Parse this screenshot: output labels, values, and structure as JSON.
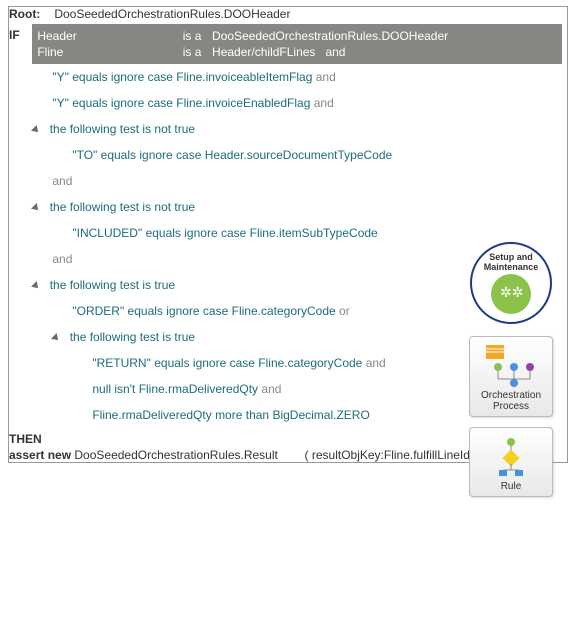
{
  "root": {
    "label": "Root:",
    "value": "DooSeededOrchestrationRules.DOOHeader"
  },
  "if_label": "IF",
  "header_block": {
    "l1c1": "Header",
    "isa": "is a",
    "l1c2": "DooSeededOrchestrationRules.DOOHeader",
    "l2c1": "Fline",
    "l2c2": "Header/childFLines",
    "and": "and"
  },
  "k": {
    "and": "and",
    "or": "or",
    "eqic": "equals ignore case",
    "nottrue": "the following test is not true",
    "istrue": "the following test is true",
    "isnt": "isn't",
    "morethan": "more than"
  },
  "c1": {
    "lit": "\"Y\"",
    "field": "Fline.invoiceableItemFlag"
  },
  "c2": {
    "lit": "\"Y\"",
    "field": "Fline.invoiceEnabledFlag"
  },
  "c3": {
    "lit": "\"TO\"",
    "field": "Header.sourceDocumentTypeCode"
  },
  "c4": {
    "lit": "\"INCLUDED\"",
    "field": "Fline.itemSubTypeCode"
  },
  "c5": {
    "lit": "\"ORDER\"",
    "field": "Fline.categoryCode"
  },
  "c6": {
    "lit": "\"RETURN\"",
    "field": "Fline.categoryCode"
  },
  "c7": {
    "null": "null",
    "field": "Fline.rmaDeliveredQty"
  },
  "c8": {
    "field": "Fline.rmaDeliveredQty",
    "val": "BigDecimal.ZERO"
  },
  "then": {
    "label": "THEN",
    "assert": "assert new",
    "result": "DooSeededOrchestrationRules.Result",
    "args": "( resultObjKey:Fline.fulfillLineId )"
  },
  "side": {
    "setup_l1": "Setup and",
    "setup_l2": "Maintenance",
    "orch_l1": "Orchestration",
    "orch_l2": "Process",
    "rule": "Rule"
  }
}
